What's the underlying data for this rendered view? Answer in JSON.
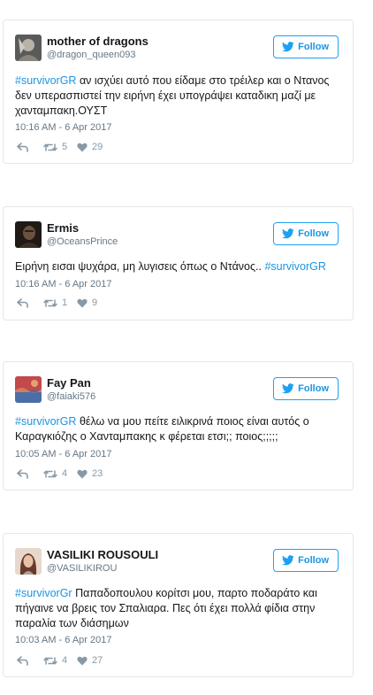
{
  "tweets": [
    {
      "display_name": "mother of dragons",
      "handle": "@dragon_queen093",
      "hashtag": "#survivorGR",
      "body": " αν ισχύει αυτό που είδαμε στο τρέιλερ και ο Ντανος δεν υπερασπιστεί την ειρήνη έχει υπογράψει καταδικη μαζί με χανταμπακη.ΟΥΣΤ",
      "timestamp": "10:16 AM - 6 Apr 2017",
      "retweets": "5",
      "likes": "29",
      "follow_label": "Follow",
      "avatar_colors": [
        "#5a5a5a",
        "#b8b2a8"
      ]
    },
    {
      "display_name": "Ermis",
      "handle": "@OceansPrince",
      "body": "Ειρήνη εισαι ψυχάρα, μη λυγισεις όπως ο Ντάνος.. ",
      "hashtag": "#survivorGR",
      "timestamp": "10:16 AM - 6 Apr 2017",
      "retweets": "1",
      "likes": "9",
      "follow_label": "Follow",
      "avatar_colors": [
        "#1f1a16",
        "#6b5140"
      ]
    },
    {
      "display_name": "Fay Pan",
      "handle": "@faiaki576",
      "hashtag": "#survivorGR",
      "body": " θέλω να μου πείτε ειλικρινά ποιος είναι αυτός ο Καραγκιόζης ο Χανταμπακης κ φέρεται ετσι;; ποιος;;;;;",
      "timestamp": "10:05 AM - 6 Apr 2017",
      "retweets": "4",
      "likes": "23",
      "follow_label": "Follow",
      "avatar_colors": [
        "#c24a4a",
        "#4a6fa8"
      ]
    },
    {
      "display_name": "VASILIKI ROUSOULI",
      "handle": "@VASILIKIROU",
      "hashtag": "#survivorGr",
      "body": " Παπαδοπουλου κορίτσι μου, παρτο ποδαράτο και πήγαινε να βρεις τον Σπαλιαρα. Πες ότι έχει πολλά φίδια στην παραλία των διάσημων",
      "timestamp": "10:03 AM - 6 Apr 2017",
      "retweets": "4",
      "likes": "27",
      "follow_label": "Follow",
      "avatar_colors": [
        "#e6d8cc",
        "#6a3b2a"
      ]
    }
  ],
  "icons": {
    "reply": "reply-icon",
    "retweet": "retweet-icon",
    "like": "heart-icon",
    "follow_bird": "twitter-bird-icon"
  },
  "colors": {
    "accent": "#1da1f2",
    "link": "#1b95e0",
    "muted": "#657786",
    "border": "#e1e8ed"
  }
}
